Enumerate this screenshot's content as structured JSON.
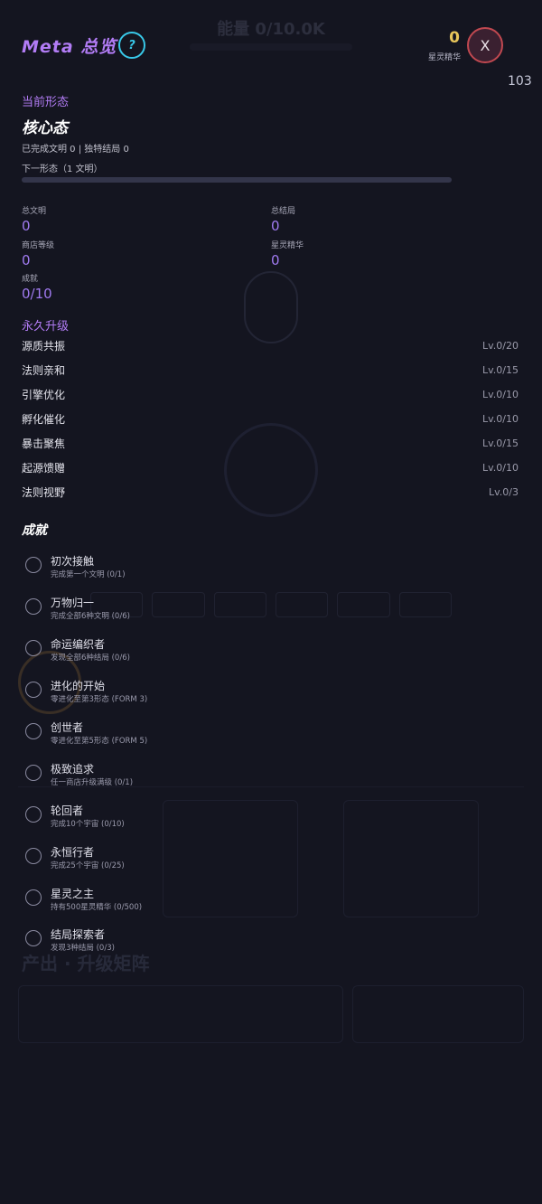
{
  "background_hint": {
    "energy_text": "能量 0/10.0K",
    "section_text": "产出 · 升级矩阵"
  },
  "header": {
    "title": "Meta 总览",
    "help_label": "?",
    "essence_value": "0",
    "essence_label": "星灵精华",
    "close_label": "X",
    "corner_count": "103"
  },
  "current_form": {
    "section_label": "当前形态",
    "name": "核心态",
    "info": "已完成文明 0 | 独特结局 0",
    "next_label": "下一形态（1 文明）",
    "progress": 0.0
  },
  "stats": [
    {
      "label": "总文明",
      "value": "0"
    },
    {
      "label": "总结局",
      "value": "0"
    },
    {
      "label": "商店等级",
      "value": "0"
    },
    {
      "label": "星灵精华",
      "value": "0"
    },
    {
      "label": "成就",
      "value": "0/10"
    }
  ],
  "upgrades": {
    "section_label": "永久升级",
    "items": [
      {
        "name": "源质共振",
        "level": "Lv.0/20"
      },
      {
        "name": "法则亲和",
        "level": "Lv.0/15"
      },
      {
        "name": "引擎优化",
        "level": "Lv.0/10"
      },
      {
        "name": "孵化催化",
        "level": "Lv.0/10"
      },
      {
        "name": "暴击聚焦",
        "level": "Lv.0/15"
      },
      {
        "name": "起源馈赠",
        "level": "Lv.0/10"
      },
      {
        "name": "法则视野",
        "level": "Lv.0/3"
      }
    ]
  },
  "achievements": {
    "section_label": "成就",
    "items": [
      {
        "title": "初次接触",
        "desc": "完成第一个文明 (0/1)"
      },
      {
        "title": "万物归一",
        "desc": "完成全部6种文明 (0/6)"
      },
      {
        "title": "命运编织者",
        "desc": "发现全部6种结局 (0/6)"
      },
      {
        "title": "进化的开始",
        "desc": "零进化至第3形态 (FORM 3)"
      },
      {
        "title": "创世者",
        "desc": "零进化至第5形态 (FORM 5)"
      },
      {
        "title": "极致追求",
        "desc": "任一商店升级满级 (0/1)"
      },
      {
        "title": "轮回者",
        "desc": "完成10个宇宙 (0/10)"
      },
      {
        "title": "永恒行者",
        "desc": "完成25个宇宙 (0/25)"
      },
      {
        "title": "星灵之主",
        "desc": "持有500星灵精华 (0/500)"
      },
      {
        "title": "结局探索者",
        "desc": "发现3种结局 (0/3)"
      }
    ]
  },
  "colors": {
    "accent": "#b27cf5",
    "help": "#38c8e8",
    "essence": "#e8c65a",
    "close_border": "#c04850"
  }
}
